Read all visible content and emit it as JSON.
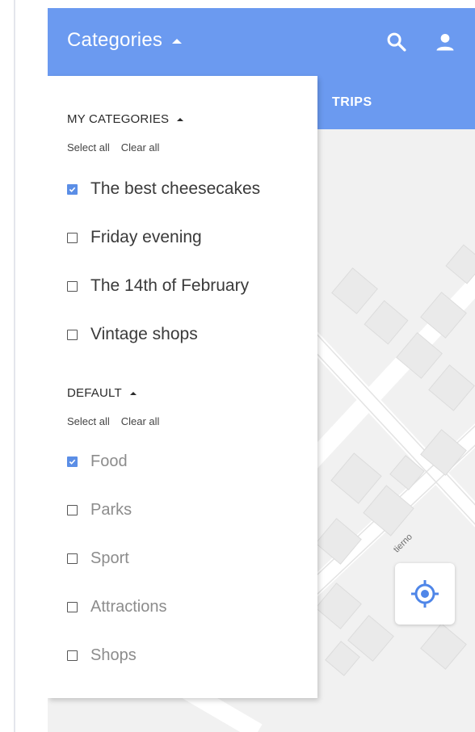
{
  "colors": {
    "accent": "#6b9af0",
    "checkbox_checked": "#5b8ee6",
    "map_background": "#f1f1f1"
  },
  "appbar": {
    "title": "Categories",
    "search_icon": "search-icon",
    "account_icon": "person-icon"
  },
  "tabs": {
    "trips_label": "TRIPS"
  },
  "panel": {
    "my_categories": {
      "header": "MY CATEGORIES",
      "select_all": "Select all",
      "clear_all": "Clear all",
      "items": [
        {
          "label": "The best cheesecakes",
          "checked": true
        },
        {
          "label": "Friday evening",
          "checked": false
        },
        {
          "label": "The 14th of February",
          "checked": false
        },
        {
          "label": "Vintage shops",
          "checked": false
        }
      ]
    },
    "default": {
      "header": "DEFAULT",
      "select_all": "Select all",
      "clear_all": "Clear all",
      "items": [
        {
          "label": "Food",
          "checked": true
        },
        {
          "label": "Parks",
          "checked": false
        },
        {
          "label": "Sport",
          "checked": false
        },
        {
          "label": "Attractions",
          "checked": false
        },
        {
          "label": "Shops",
          "checked": false
        }
      ]
    }
  },
  "map": {
    "street_label": "tierno",
    "location_button_icon": "my-location-icon"
  }
}
